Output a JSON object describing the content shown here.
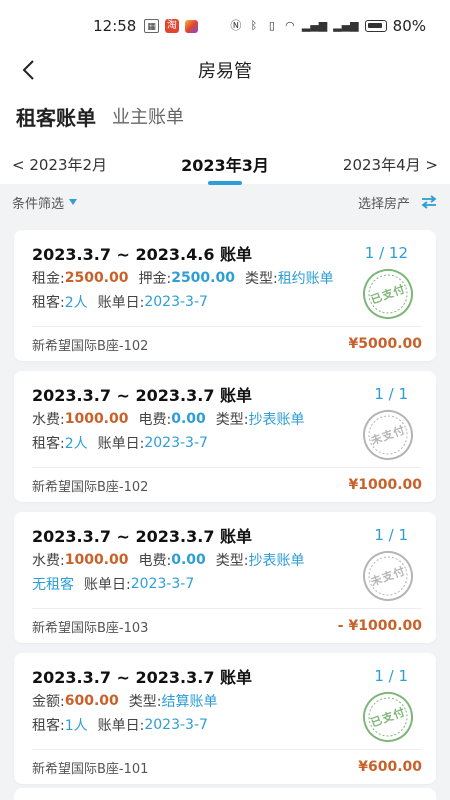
{
  "status_bar": {
    "time": "12:58",
    "battery": "80%"
  },
  "nav": {
    "title": "房易管"
  },
  "tabs": [
    {
      "label": "租客账单",
      "active": true
    },
    {
      "label": "业主账单",
      "active": false
    }
  ],
  "months": {
    "prev": "< 2023年2月",
    "current": "2023年3月",
    "next": "2023年4月 >"
  },
  "filters": {
    "condition": "条件筛选",
    "select_property": "选择房产"
  },
  "cards": [
    {
      "title": "2023.3.7 ~ 2023.4.6 账单",
      "count": "1 / 12",
      "row1": [
        {
          "label": "租金:",
          "value": "2500.00",
          "style": "orange"
        },
        {
          "label": "押金:",
          "value": "2500.00",
          "style": "blue"
        },
        {
          "label": "类型:",
          "value": "租约账单",
          "style": "link"
        }
      ],
      "row2": [
        {
          "label": "租客:",
          "value": "2人",
          "style": "link"
        },
        {
          "label": "账单日:",
          "value": "2023-3-7",
          "style": "link"
        }
      ],
      "stamp": "已支付",
      "stamp_state": "paid",
      "building": "新希望国际B座-102",
      "amount": "¥5000.00"
    },
    {
      "title": "2023.3.7 ~ 2023.3.7 账单",
      "count": "1 / 1",
      "row1": [
        {
          "label": "水费:",
          "value": "1000.00",
          "style": "orange"
        },
        {
          "label": "电费:",
          "value": "0.00",
          "style": "blue"
        },
        {
          "label": "类型:",
          "value": "抄表账单",
          "style": "link"
        }
      ],
      "row2": [
        {
          "label": "租客:",
          "value": "2人",
          "style": "link"
        },
        {
          "label": "账单日:",
          "value": "2023-3-7",
          "style": "link"
        }
      ],
      "stamp": "未支付",
      "stamp_state": "unpaid",
      "building": "新希望国际B座-102",
      "amount": "¥1000.00"
    },
    {
      "title": "2023.3.7 ~ 2023.3.7 账单",
      "count": "1 / 1",
      "row1": [
        {
          "label": "水费:",
          "value": "1000.00",
          "style": "orange"
        },
        {
          "label": "电费:",
          "value": "0.00",
          "style": "blue"
        },
        {
          "label": "类型:",
          "value": "抄表账单",
          "style": "link"
        }
      ],
      "row2": [
        {
          "label": "",
          "value": "无租客",
          "style": "link"
        },
        {
          "label": "账单日:",
          "value": "2023-3-7",
          "style": "link"
        }
      ],
      "stamp": "未支付",
      "stamp_state": "unpaid",
      "building": "新希望国际B座-103",
      "amount": "- ¥1000.00"
    },
    {
      "title": "2023.3.7 ~ 2023.3.7 账单",
      "count": "1 / 1",
      "row1": [
        {
          "label": "金额:",
          "value": "600.00",
          "style": "orange"
        },
        {
          "label": "类型:",
          "value": "结算账单",
          "style": "link"
        }
      ],
      "row2": [
        {
          "label": "租客:",
          "value": "1人",
          "style": "link"
        },
        {
          "label": "账单日:",
          "value": "2023-3-7",
          "style": "link"
        }
      ],
      "stamp": "已支付",
      "stamp_state": "paid",
      "building": "新希望国际B座-101",
      "amount": "¥600.00"
    }
  ],
  "colors": {
    "accent": "#2e9ed6",
    "amount": "#c8612a",
    "paid_stamp": "#7fb67a",
    "unpaid_stamp": "#b5b5b5"
  }
}
